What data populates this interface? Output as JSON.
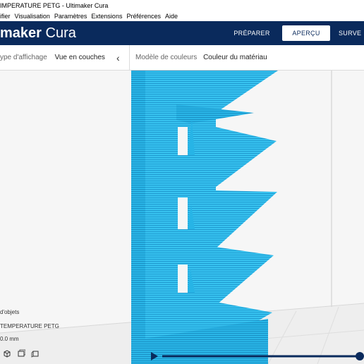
{
  "window": {
    "title": "IMPERATURE PETG - Ultimaker Cura"
  },
  "menu": {
    "items": [
      {
        "label": "ifier"
      },
      {
        "label": "Visualisation"
      },
      {
        "label": "Paramètres"
      },
      {
        "label": "Extensions"
      },
      {
        "label": "Préférences"
      },
      {
        "label": "Aide"
      }
    ]
  },
  "header": {
    "logo_bold": "maker",
    "logo_light": "Cura",
    "tabs": {
      "prepare": "PRÉPARER",
      "preview": "APERÇU",
      "monitor": "SURVE"
    }
  },
  "view_options": {
    "view_type_label": "ype d'affichage",
    "view_type_value": "Vue en couches",
    "color_scheme_label": "Modèle de couleurs",
    "color_scheme_value": "Couleur du matériau"
  },
  "object_info": {
    "objects_label": "d'objets",
    "object_name": "TEMPERATURE PETG",
    "dimension": "0.0 mm"
  },
  "icons": {
    "view_3d": "cube-icon",
    "view_front": "cube-front-icon",
    "view_side": "cube-side-icon"
  },
  "colors": {
    "header_bg": "#0a2a5c",
    "model": "#27b4e6",
    "model_dark": "#1690c4",
    "slider": "#0a2a5c"
  }
}
